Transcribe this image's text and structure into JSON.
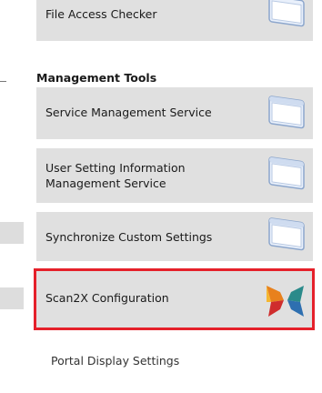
{
  "tiles": {
    "file_access": {
      "label": "File Access Checker",
      "icon": "window-app-icon"
    },
    "service_mgmt": {
      "label": "Service Management Service",
      "icon": "window-app-icon"
    },
    "user_setting": {
      "label": "User Setting Information Management Service",
      "icon": "window-app-icon"
    },
    "sync_custom": {
      "label": "Synchronize Custom Settings",
      "icon": "window-app-icon"
    },
    "scan2x": {
      "label": "Scan2X Configuration",
      "icon": "scan2x-logo-icon"
    }
  },
  "section": {
    "management_tools": "Management Tools"
  },
  "links": {
    "portal_display": "Portal Display Settings"
  },
  "colors": {
    "tile_bg": "#e0e0e0",
    "highlight": "#e5202a"
  }
}
